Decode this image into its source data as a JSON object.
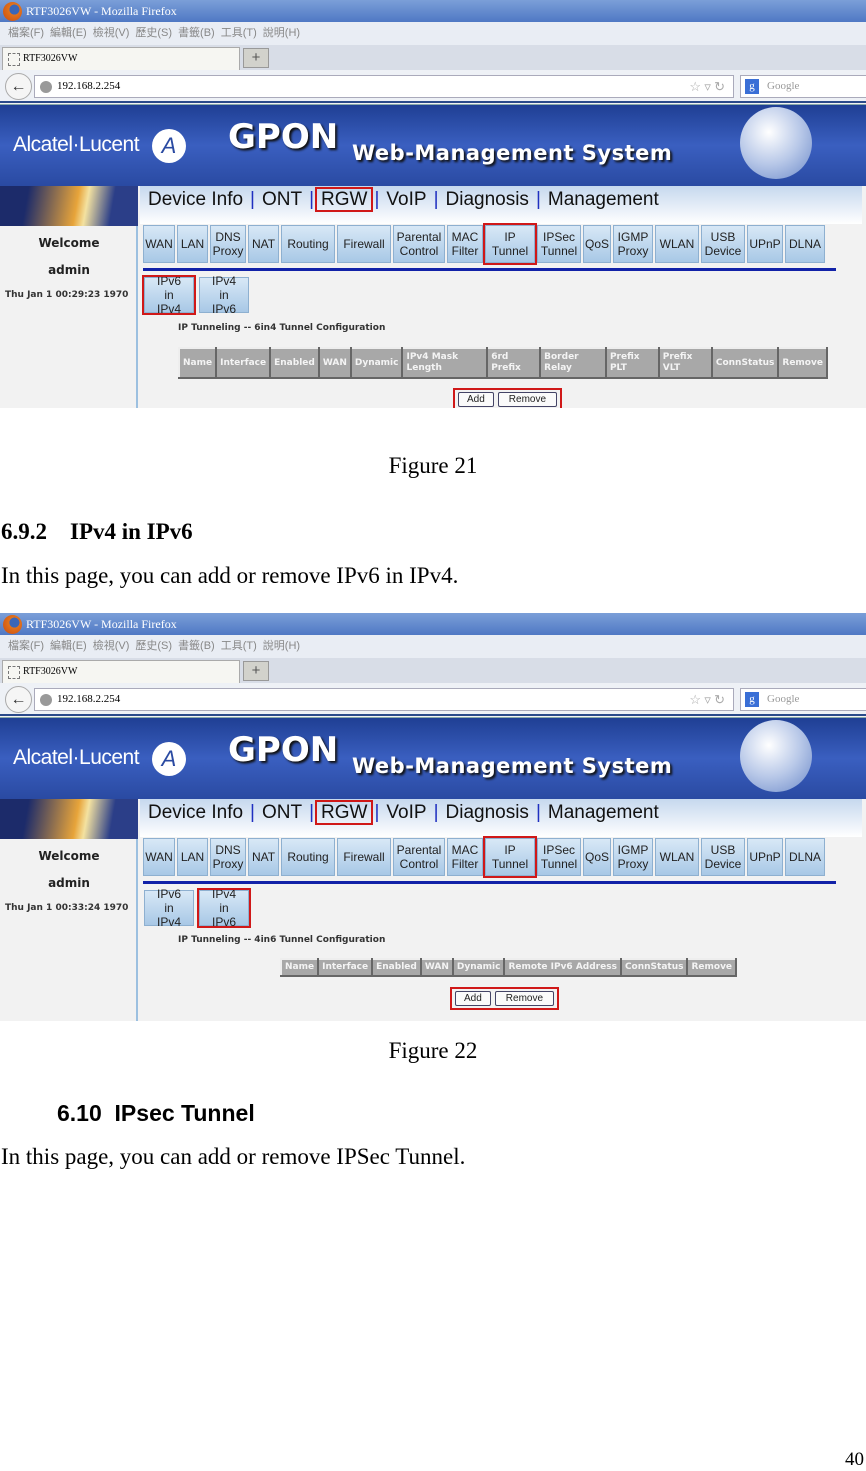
{
  "browser": {
    "window_title": "RTF3026VW - Mozilla Firefox",
    "menu": [
      "檔案(F)",
      "編輯(E)",
      "檢視(V)",
      "歷史(S)",
      "書籤(B)",
      "工具(T)",
      "說明(H)"
    ],
    "tab_title": "RTF3026VW",
    "new_tab": "+",
    "url": "192.168.2.254",
    "search_placeholder": "Google"
  },
  "banner": {
    "brand": "Alcatel·Lucent",
    "title": "GPON",
    "subtitle": "Web-Management System"
  },
  "top_nav": [
    "Device Info",
    "ONT",
    "RGW",
    "VoIP",
    "Diagnosis",
    "Management"
  ],
  "sub_nav": [
    "WAN",
    "LAN",
    "DNS Proxy",
    "NAT",
    "Routing",
    "Firewall",
    "Parental Control",
    "MAC Filter",
    "IP Tunnel",
    "IPSec Tunnel",
    "QoS",
    "IGMP Proxy",
    "WLAN",
    "USB Device",
    "UPnP",
    "DLNA"
  ],
  "tunnel_tabs": [
    "IPv6 in IPv4",
    "IPv4 in IPv6"
  ],
  "left": {
    "welcome": "Welcome",
    "user": "admin"
  },
  "buttons": {
    "add": "Add",
    "remove": "Remove"
  },
  "screens": [
    {
      "date": "Thu Jan 1 00:29:23 1970",
      "active_tunnel_tab": 0,
      "caption": "IP Tunneling -- 6in4 Tunnel Configuration",
      "columns": [
        "Name",
        "Interface",
        "Enabled",
        "WAN",
        "Dynamic",
        "IPv4 Mask Length",
        "6rd Prefix",
        "Border Relay",
        "Prefix PLT",
        "Prefix VLT",
        "ConnStatus",
        "Remove"
      ]
    },
    {
      "date": "Thu Jan 1 00:33:24 1970",
      "active_tunnel_tab": 1,
      "caption": "IP Tunneling -- 4in6 Tunnel Configuration",
      "columns": [
        "Name",
        "Interface",
        "Enabled",
        "WAN",
        "Dynamic",
        "Remote IPv6 Address",
        "ConnStatus",
        "Remove"
      ]
    }
  ],
  "document": {
    "figure21": "Figure 21",
    "section_692": "6.9.2    IPv4 in IPv6",
    "para_692": "In this page, you can add or remove IPv6 in IPv4.",
    "figure22": "Figure 22",
    "section_610": "6.10  IPsec Tunnel",
    "para_610": "In this page, you can add or remove IPSec Tunnel.",
    "page_number": "40"
  },
  "colors": {
    "highlight": "#d01818",
    "nav_separator": "#2030c0",
    "banner": "#2a4aa2"
  }
}
